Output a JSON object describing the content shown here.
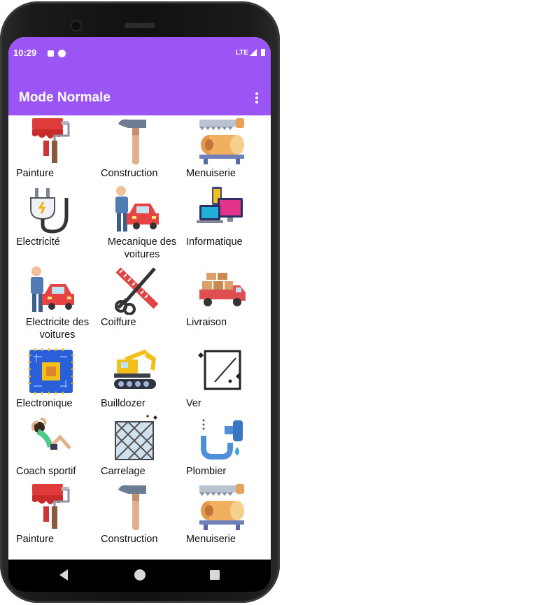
{
  "status_bar": {
    "time": "10:29",
    "network": "LTE"
  },
  "app_bar": {
    "title": "Mode Normale",
    "menu_icon": "more-vert-icon"
  },
  "services": [
    {
      "label": "Painture",
      "icon": "paint-roller-icon"
    },
    {
      "label": "Construction",
      "icon": "hammer-icon"
    },
    {
      "label": "Menuiserie",
      "icon": "saw-wood-icon"
    },
    {
      "label": "Electricité",
      "icon": "plug-icon"
    },
    {
      "label": "Mecanique des voitures",
      "icon": "car-mechanic-icon"
    },
    {
      "label": "Informatique",
      "icon": "computer-icon"
    },
    {
      "label": "Electricite des voitures",
      "icon": "car-mechanic-icon"
    },
    {
      "label": "Coiffure",
      "icon": "scissors-comb-icon"
    },
    {
      "label": "Livraison",
      "icon": "delivery-truck-icon"
    },
    {
      "label": "Electronique",
      "icon": "circuit-chip-icon"
    },
    {
      "label": "Builldozer",
      "icon": "excavator-icon"
    },
    {
      "label": "Ver",
      "icon": "glass-pane-icon"
    },
    {
      "label": "Coach sportif",
      "icon": "fitness-icon"
    },
    {
      "label": "Carrelage",
      "icon": "tiles-icon"
    },
    {
      "label": "Plombier",
      "icon": "faucet-pipe-icon"
    },
    {
      "label": "Painture",
      "icon": "paint-roller-icon"
    },
    {
      "label": "Construction",
      "icon": "hammer-icon"
    },
    {
      "label": "Menuiserie",
      "icon": "saw-wood-icon"
    }
  ],
  "nav": {
    "back_icon": "back-icon",
    "home_icon": "home-icon",
    "recents_icon": "recents-icon"
  },
  "colors": {
    "accent": "#9b55f5"
  }
}
